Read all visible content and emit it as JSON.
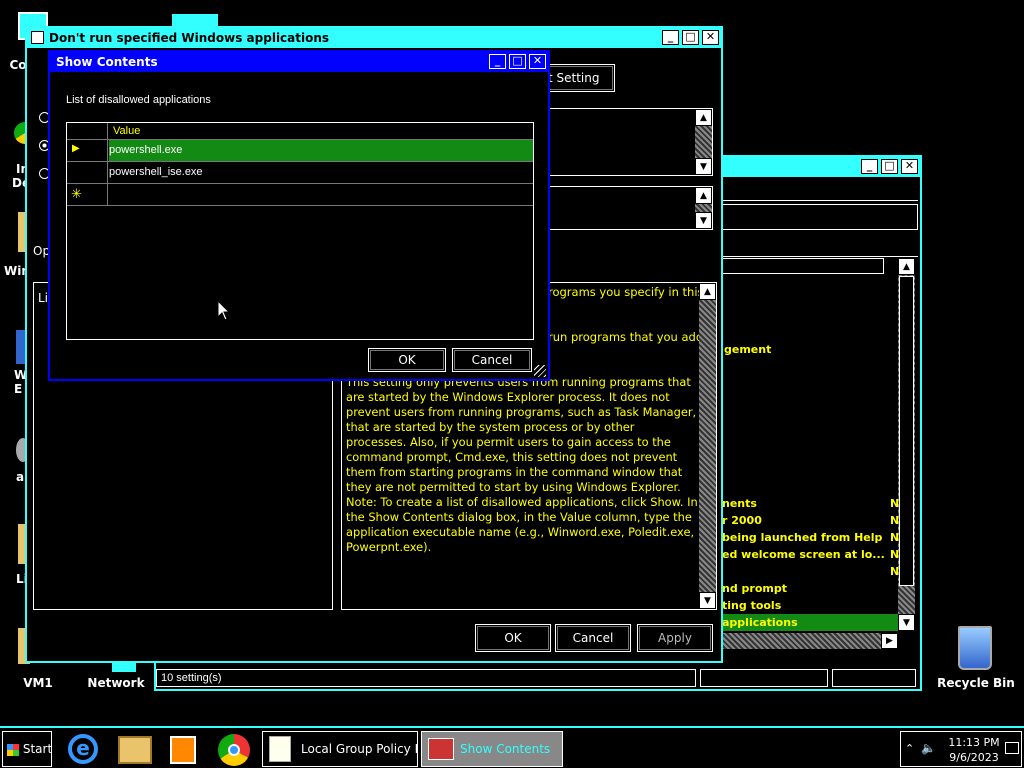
{
  "desktop": {
    "icons": [
      {
        "label": "Co",
        "icon": "computer-icon"
      },
      {
        "label": "In\nDe",
        "icon": "chrome-icon"
      },
      {
        "label": "Win",
        "icon": "folder-icon"
      },
      {
        "label": "W\nE",
        "icon": "settings-icon"
      },
      {
        "label": "a",
        "icon": "gear-icon"
      },
      {
        "label": "Li",
        "icon": "folder-icon"
      },
      {
        "label": "VM1",
        "icon": "vm-icon"
      },
      {
        "label": "Network",
        "icon": "network-icon"
      },
      {
        "label": "Recycle Bin",
        "icon": "recycle-bin-icon"
      }
    ]
  },
  "gpedit_window": {
    "buttons": [
      "min",
      "max",
      "close"
    ],
    "settings_entries": [
      {
        "name": "nents",
        "state": "N"
      },
      {
        "name": "r 2000",
        "state": "N"
      },
      {
        "name": "being launched from Help",
        "state": "N"
      },
      {
        "name": "ed welcome screen at lo...",
        "state": "N"
      },
      {
        "name": "",
        "state": "N"
      },
      {
        "name": "nd prompt",
        "state": ""
      },
      {
        "name": "ting tools",
        "state": ""
      },
      {
        "name": "applications",
        "state": ""
      }
    ],
    "mid_label": "gement",
    "status": "10 setting(s)"
  },
  "policy_dialog": {
    "title": "Don't run specified Windows applications",
    "next_setting_label": "t Setting",
    "options_label": "Op",
    "list_label": "Lis",
    "help_text_top1": "rograms you specify in this",
    "help_text_top2": "run programs that you add",
    "help_text_main": "This setting only prevents users from running programs that are started by the Windows Explorer process. It does not prevent users from running programs, such as Task Manager, that are started by the system process or by other processes. Also, if you permit users to gain access to the command prompt, Cmd.exe, this setting does not prevent them from starting programs in the command window that they are not permitted to start by using Windows Explorer. Note: To create a list of disallowed applications, click Show. In the Show Contents dialog box, in the Value column, type the application executable name (e.g., Winword.exe, Poledit.exe, Powerpnt.exe).",
    "ok_label": "OK",
    "cancel_label": "Cancel",
    "apply_label": "Apply"
  },
  "show_contents": {
    "title": "Show Contents",
    "list_label": "List of disallowed applications",
    "column_header": "Value",
    "rows": [
      "powershell.exe",
      "powershell_ise.exe"
    ],
    "ok_label": "OK",
    "cancel_label": "Cancel"
  },
  "taskbar": {
    "start_label": "Start",
    "tasks": [
      {
        "label": "Local Group Policy Edi...",
        "icon": "notepad-icon"
      },
      {
        "label": "Show Contents",
        "icon": "toolbox-icon"
      }
    ],
    "time": "11:13 PM",
    "date": "9/6/2023"
  },
  "colors": {
    "accent": "#33ffff",
    "title_blue": "#0000ff",
    "select_green": "#138a13",
    "text_yellow": "#ffff00"
  }
}
